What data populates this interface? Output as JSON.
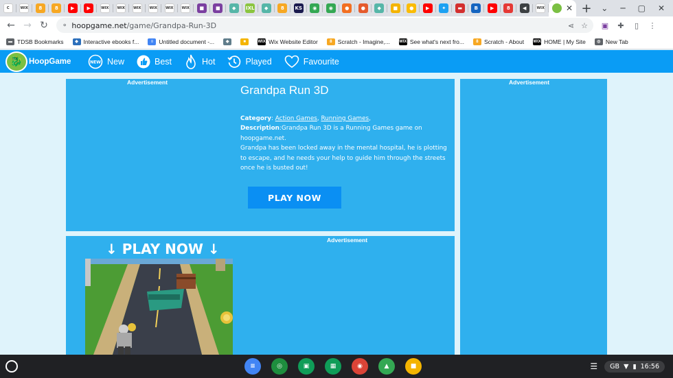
{
  "browser": {
    "tabs": [
      {
        "icon": "loading-icon",
        "color": "#ffffff",
        "glyph": "C"
      },
      {
        "icon": "wix-icon",
        "color": "#ffffff",
        "glyph": "WIX"
      },
      {
        "icon": "scratch-icon",
        "color": "#f7a823",
        "glyph": "8"
      },
      {
        "icon": "scratch-icon",
        "color": "#f7a823",
        "glyph": "8"
      },
      {
        "icon": "youtube-icon",
        "color": "#ff0000",
        "glyph": "▶"
      },
      {
        "icon": "youtube-icon",
        "color": "#ff0000",
        "glyph": "▶"
      },
      {
        "icon": "wix-icon",
        "color": "#ffffff",
        "glyph": "WIX"
      },
      {
        "icon": "wix-icon",
        "color": "#ffffff",
        "glyph": "WIX"
      },
      {
        "icon": "wix-icon",
        "color": "#ffffff",
        "glyph": "WIX"
      },
      {
        "icon": "wix-icon",
        "color": "#ffffff",
        "glyph": "WIX"
      },
      {
        "icon": "wix-icon",
        "color": "#ffffff",
        "glyph": "WIX"
      },
      {
        "icon": "wix-icon",
        "color": "#ffffff",
        "glyph": "WIX"
      },
      {
        "icon": "purple-app-icon",
        "color": "#7b3fa0",
        "glyph": "■"
      },
      {
        "icon": "purple-app-icon",
        "color": "#7b3fa0",
        "glyph": "■"
      },
      {
        "icon": "paint-icon",
        "color": "#56b6a8",
        "glyph": "◆"
      },
      {
        "icon": "ixl-icon",
        "color": "#8bc53f",
        "glyph": "IXL"
      },
      {
        "icon": "paint-icon",
        "color": "#56b6a8",
        "glyph": "◆"
      },
      {
        "icon": "scratch-icon",
        "color": "#f7a823",
        "glyph": "8"
      },
      {
        "icon": "ks-icon",
        "color": "#1a1a4e",
        "glyph": "KS"
      },
      {
        "icon": "maps-icon",
        "color": "#34a853",
        "glyph": "◉"
      },
      {
        "icon": "maps-icon",
        "color": "#34a853",
        "glyph": "◉"
      },
      {
        "icon": "orange-circle-icon",
        "color": "#f26f21",
        "glyph": "●"
      },
      {
        "icon": "orange-circle-icon",
        "color": "#e55b2d",
        "glyph": "●"
      },
      {
        "icon": "paint-icon",
        "color": "#56b6a8",
        "glyph": "◆"
      },
      {
        "icon": "slides-icon",
        "color": "#f4b400",
        "glyph": "■"
      },
      {
        "icon": "chrome-icon",
        "color": "#fbbc05",
        "glyph": "●"
      },
      {
        "icon": "youtube-icon",
        "color": "#ff0000",
        "glyph": "▶"
      },
      {
        "icon": "twitter-icon",
        "color": "#1da1f2",
        "glyph": "✦"
      },
      {
        "icon": "news-icon",
        "color": "#d32f2f",
        "glyph": "▬"
      },
      {
        "icon": "b-icon",
        "color": "#1565c0",
        "glyph": "B"
      },
      {
        "icon": "youtube-icon",
        "color": "#ff0000",
        "glyph": "▶"
      },
      {
        "icon": "scratch-icon",
        "color": "#e53935",
        "glyph": "8"
      },
      {
        "icon": "audio-icon",
        "color": "#3c4043",
        "glyph": "◀"
      },
      {
        "icon": "wix-icon",
        "color": "#ffffff",
        "glyph": "WIX"
      }
    ],
    "active_tab": {
      "icon": "hoopgame-icon",
      "close": "✕"
    },
    "new_tab": "+",
    "address": {
      "host": "hoopgame.net",
      "path": "/game/Grandpa-Run-3D"
    },
    "bookmarks": [
      {
        "label": "TDSB Bookmarks",
        "icon": "folder-icon",
        "color": "#5f6368",
        "glyph": "▬"
      },
      {
        "label": "Interactive ebooks f...",
        "icon": "ebooks-icon",
        "color": "#2c6fbb",
        "glyph": "◆"
      },
      {
        "label": "Untitled document -...",
        "icon": "docs-icon",
        "color": "#4285f4",
        "glyph": "≡"
      },
      {
        "label": "",
        "icon": "books-icon",
        "color": "#607d8b",
        "glyph": "◆"
      },
      {
        "label": "",
        "icon": "image-icon",
        "color": "#f4b400",
        "glyph": "■"
      },
      {
        "label": "Wix Website Editor",
        "icon": "wix-icon",
        "color": "#000000",
        "glyph": "WIX"
      },
      {
        "label": "Scratch - Imagine,...",
        "icon": "scratch-icon",
        "color": "#f7a823",
        "glyph": "8"
      },
      {
        "label": "See what's next fro...",
        "icon": "wix-icon",
        "color": "#000000",
        "glyph": "WIX"
      },
      {
        "label": "Scratch - About",
        "icon": "scratch-icon",
        "color": "#f7a823",
        "glyph": "8"
      },
      {
        "label": "HOME | My Site",
        "icon": "wix-icon",
        "color": "#000000",
        "glyph": "WIX"
      },
      {
        "label": "New Tab",
        "icon": "globe-icon",
        "color": "#5f6368",
        "glyph": "◎"
      }
    ]
  },
  "site": {
    "logo": "HoopGame",
    "nav": [
      {
        "label": "New",
        "icon": "new-icon"
      },
      {
        "label": "Best",
        "icon": "thumbs-up-icon"
      },
      {
        "label": "Hot",
        "icon": "flame-icon"
      },
      {
        "label": "Played",
        "icon": "history-icon"
      },
      {
        "label": "Favourite",
        "icon": "heart-icon"
      }
    ]
  },
  "game": {
    "ad_label": "Advertisement",
    "title": "Grandpa Run 3D",
    "category_label": "Category",
    "categories": [
      "Action Games",
      "Running Games"
    ],
    "description_label": "Description",
    "description": "Grandpa Run 3D is a Running Games game on hoopgame.net.",
    "long_description": "Grandpa has been locked away in the mental hospital, he is plotting to escape, and he needs your help to guide him through the streets once he is busted out!",
    "play_button": "PLAY NOW",
    "play_now_big": "↓ PLAY NOW ↓"
  },
  "os": {
    "time": "16:56",
    "locale": "GB",
    "shelf_apps": [
      {
        "icon": "docs-app-icon",
        "color": "#4285f4",
        "glyph": "≡"
      },
      {
        "icon": "classroom-sync-icon",
        "color": "#1e8e3e",
        "glyph": "◎"
      },
      {
        "icon": "classroom-icon",
        "color": "#0f9d58",
        "glyph": "▣"
      },
      {
        "icon": "sheets-icon",
        "color": "#0f9d58",
        "glyph": "▦"
      },
      {
        "icon": "chrome-app-icon",
        "color": "#db4437",
        "glyph": "◉"
      },
      {
        "icon": "drive-icon",
        "color": "#34a853",
        "glyph": "▲"
      },
      {
        "icon": "slides-app-icon",
        "color": "#f4b400",
        "glyph": "■"
      }
    ]
  }
}
